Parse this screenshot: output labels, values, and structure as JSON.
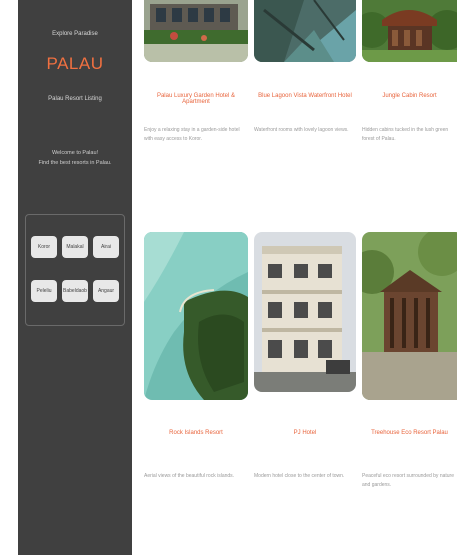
{
  "sidebar": {
    "top_text": "Explore Paradise",
    "logo": "PALAU",
    "tagline": "Palau Resort Listing",
    "welcome_line1": "Welcome to Palau!",
    "welcome_line2": "Find the best resorts in Palau.",
    "filters": [
      "Koror",
      "Malakal",
      "Airai",
      "Peleliu",
      "Babeldaob",
      "Angaur"
    ]
  },
  "cards": [
    {
      "title": "Palau Luxury Garden Hotel & Apartment",
      "desc": "Enjoy a relaxing stay in a garden-side hotel with easy access to Koror."
    },
    {
      "title": "Blue Lagoon Vista Waterfront Hotel",
      "desc": "Waterfront rooms with lovely lagoon views."
    },
    {
      "title": "Jungle Cabin Resort",
      "desc": "Hidden cabins tucked in the lush green forest of Palau."
    },
    {
      "title": "Rock Islands Resort",
      "desc": "Aerial views of the beautiful rock islands."
    },
    {
      "title": "PJ Hotel",
      "desc": "Modern hotel close to the center of town."
    },
    {
      "title": "Treehouse Eco Resort Palau",
      "desc": "Peaceful eco resort surrounded by nature and gardens."
    }
  ],
  "colors": {
    "accent": "#e8643c",
    "sidebar": "#404040"
  }
}
